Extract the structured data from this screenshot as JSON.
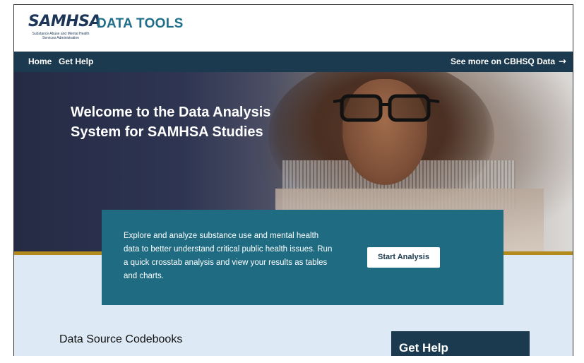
{
  "brand": {
    "logo_word": "SAMHSA",
    "logo_subtitle": "Substance Abuse and Mental Health Services Administration",
    "app_title": "DATA TOOLS",
    "colors": {
      "navy": "#1c3a4f",
      "teal": "#1e6b82",
      "gold": "#b38b1d",
      "light_blue": "#dde9f4",
      "title_teal": "#1f6f8b"
    }
  },
  "nav": {
    "items": [
      {
        "label": "Home"
      },
      {
        "label": "Get Help"
      }
    ],
    "external_link": {
      "label": "See more on CBHSQ Data",
      "icon": "arrow-right-icon"
    }
  },
  "hero": {
    "title": "Welcome to the Data Analysis System for SAMHSA Studies"
  },
  "callout": {
    "text": "Explore and analyze substance use and mental health data to better understand critical public health issues. Run a quick crosstab analysis and view your results as tables and charts.",
    "button_label": "Start Analysis"
  },
  "sections": {
    "codebooks_heading": "Data Source Codebooks",
    "help_heading": "Get Help"
  }
}
